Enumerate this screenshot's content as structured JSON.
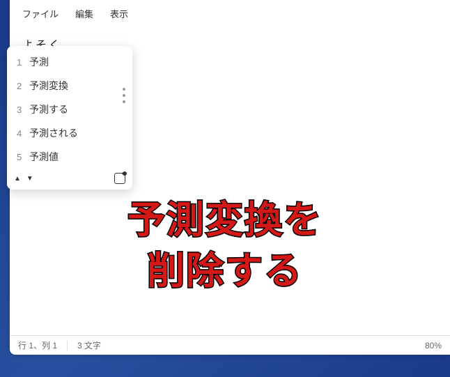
{
  "menubar": {
    "file": "ファイル",
    "edit": "編集",
    "view": "表示"
  },
  "ime": {
    "input_text": "よそく",
    "candidates": [
      {
        "num": "1",
        "text": "予測"
      },
      {
        "num": "2",
        "text": "予測変換"
      },
      {
        "num": "3",
        "text": "予測する"
      },
      {
        "num": "4",
        "text": "予測される"
      },
      {
        "num": "5",
        "text": "予測値"
      }
    ],
    "prev_arrow": "▲",
    "next_arrow": "▼"
  },
  "overlay": {
    "line1": "予測変換を",
    "line2": "削除する"
  },
  "statusbar": {
    "position": "行 1、列 1",
    "chars": "3 文字",
    "zoom": "80%"
  }
}
